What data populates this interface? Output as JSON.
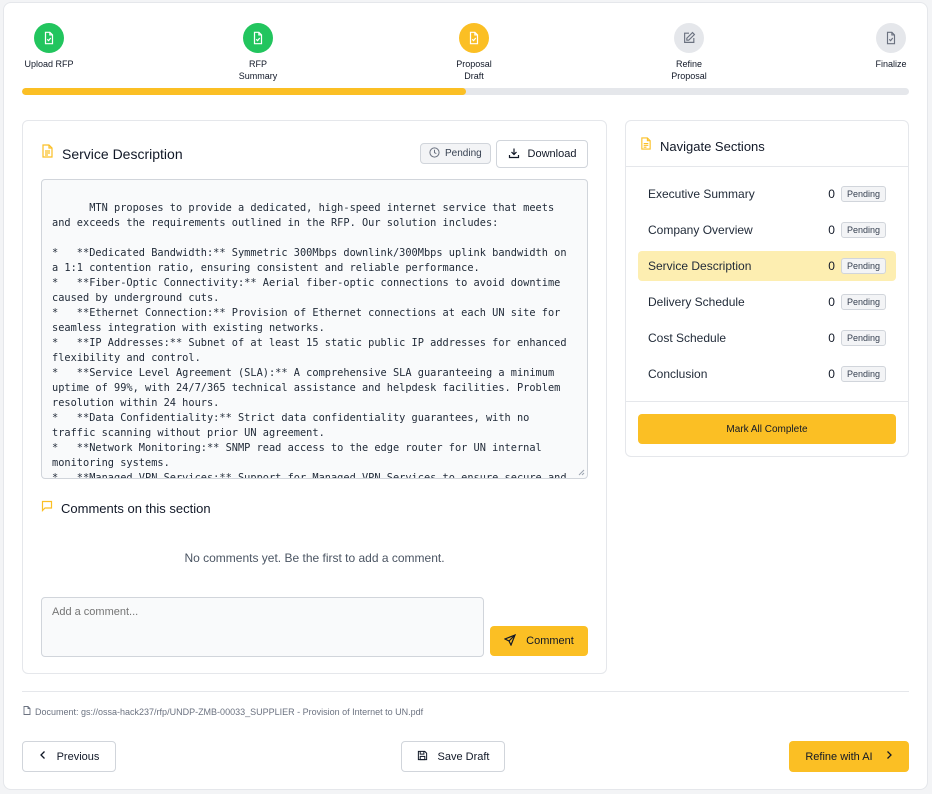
{
  "stepper": {
    "steps": [
      {
        "label": "Upload RFP",
        "state": "complete"
      },
      {
        "label": "RFP\nSummary",
        "state": "complete"
      },
      {
        "label": "Proposal\nDraft",
        "state": "current"
      },
      {
        "label": "Refine\nProposal",
        "state": "pending"
      },
      {
        "label": "Finalize",
        "state": "pending"
      }
    ],
    "progress_fraction": 0.5
  },
  "section": {
    "title": "Service Description",
    "status_badge": "Pending",
    "download_label": "Download",
    "content": "MTN proposes to provide a dedicated, high-speed internet service that meets and exceeds the requirements outlined in the RFP. Our solution includes:\n\n*   **Dedicated Bandwidth:** Symmetric 300Mbps downlink/300Mbps uplink bandwidth on a 1:1 contention ratio, ensuring consistent and reliable performance.\n*   **Fiber-Optic Connectivity:** Aerial fiber-optic connections to avoid downtime caused by underground cuts.\n*   **Ethernet Connection:** Provision of Ethernet connections at each UN site for seamless integration with existing networks.\n*   **IP Addresses:** Subnet of at least 15 static public IP addresses for enhanced flexibility and control.\n*   **Service Level Agreement (SLA):** A comprehensive SLA guaranteeing a minimum uptime of 99%, with 24/7/365 technical assistance and helpdesk facilities. Problem resolution within 24 hours.\n*   **Data Confidentiality:** Strict data confidentiality guarantees, with no traffic scanning without prior UN agreement.\n*   **Network Monitoring:** SNMP read access to the edge router for UN internal monitoring systems.\n*   **Managed VPN Services:** Support for Managed VPN Services to ensure secure and reliable data transmission."
  },
  "comments": {
    "title": "Comments on this section",
    "empty_text": "No comments yet. Be the first to add a comment.",
    "input_placeholder": "Add a comment...",
    "submit_label": "Comment"
  },
  "navigation": {
    "title": "Navigate Sections",
    "items": [
      {
        "label": "Executive Summary",
        "count": "0",
        "status": "Pending"
      },
      {
        "label": "Company Overview",
        "count": "0",
        "status": "Pending"
      },
      {
        "label": "Service Description",
        "count": "0",
        "status": "Pending"
      },
      {
        "label": "Delivery Schedule",
        "count": "0",
        "status": "Pending"
      },
      {
        "label": "Cost Schedule",
        "count": "0",
        "status": "Pending"
      },
      {
        "label": "Conclusion",
        "count": "0",
        "status": "Pending"
      }
    ],
    "active_index": 2,
    "mark_all_label": "Mark All Complete"
  },
  "footer": {
    "document_path": "Document: gs://ossa-hack237/rfp/UNDP-ZMB-00033_SUPPLIER - Provision of Internet to UN.pdf",
    "previous_label": "Previous",
    "save_draft_label": "Save Draft",
    "refine_label": "Refine with AI"
  },
  "colors": {
    "accent": "#fbbf24",
    "complete": "#22c55e",
    "pending_step": "#e5e7eb",
    "active_nav_bg": "#fdeeb1"
  },
  "icons": {
    "step_complete": "file-check-icon",
    "step_current": "file-check-icon",
    "step_refine": "pencil-square-icon",
    "step_finalize": "file-check-icon",
    "section": "document-icon",
    "comments": "chat-bubble-icon",
    "download": "download-icon",
    "pending": "clock-icon",
    "comment_submit": "send-icon"
  }
}
